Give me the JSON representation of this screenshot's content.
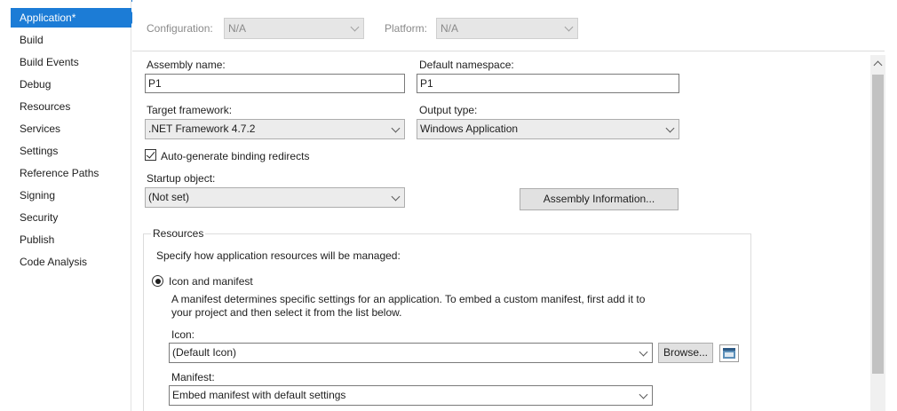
{
  "sidebar": {
    "items": [
      {
        "label": "Application*",
        "active": true
      },
      {
        "label": "Build"
      },
      {
        "label": "Build Events"
      },
      {
        "label": "Debug"
      },
      {
        "label": "Resources"
      },
      {
        "label": "Services"
      },
      {
        "label": "Settings"
      },
      {
        "label": "Reference Paths"
      },
      {
        "label": "Signing"
      },
      {
        "label": "Security"
      },
      {
        "label": "Publish"
      },
      {
        "label": "Code Analysis"
      }
    ]
  },
  "config": {
    "configuration_label": "Configuration:",
    "configuration_value": "N/A",
    "platform_label": "Platform:",
    "platform_value": "N/A"
  },
  "form": {
    "assembly_name_label": "Assembly name:",
    "assembly_name_value": "P1",
    "default_namespace_label": "Default namespace:",
    "default_namespace_value": "P1",
    "target_framework_label": "Target framework:",
    "target_framework_value": ".NET Framework 4.7.2",
    "output_type_label": "Output type:",
    "output_type_value": "Windows Application",
    "auto_binding_label": "Auto-generate binding redirects",
    "auto_binding_checked": true,
    "startup_object_label": "Startup object:",
    "startup_object_value": "(Not set)",
    "assembly_info_button": "Assembly Information..."
  },
  "resources": {
    "group_title": "Resources",
    "description": "Specify how application resources will be managed:",
    "icon_manifest_label": "Icon and manifest",
    "icon_manifest_selected": true,
    "manifest_help_line1": "A manifest determines specific settings for an application. To embed a custom manifest, first add it to",
    "manifest_help_line2": "your project and then select it from the list below.",
    "icon_label": "Icon:",
    "icon_value": "(Default Icon)",
    "browse_button": "Browse...",
    "manifest_label": "Manifest:",
    "manifest_value": "Embed manifest with default settings"
  },
  "colors": {
    "accent": "#1c7cd6",
    "disabled_bg": "#e6e6e6"
  }
}
